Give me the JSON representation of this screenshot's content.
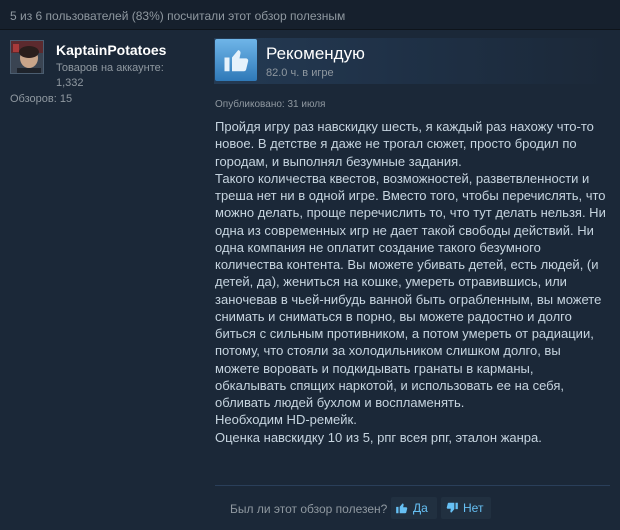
{
  "helpful_summary": "5 из 6 пользователей (83%) посчитали этот обзор полезным",
  "author": {
    "username": "KaptainPotatoes",
    "products_label": "Товаров на аккаунте:",
    "products_count": "1,332",
    "reviews_label": "Обзоров: 15"
  },
  "review": {
    "verdict": "Рекомендую",
    "hours": "82.0 ч. в игре",
    "posted": "Опубликовано: 31 июля",
    "paragraphs": [
      "Пройдя игру раз навскидку шесть, я каждый раз нахожу что-то новое. В детстве я даже не трогал сюжет, просто бродил по городам, и выполнял безумные задания.",
      "Такого количества квестов, возможностей, разветвленности и треша нет ни в одной игре. Вместо того, чтобы перечислять, что можно делать, проще перечислить то, что тут делать нельзя. Ни одна из современных игр не дает такой свободы действий. Ни одна компания не оплатит создание такого безумного количества контента. Вы можете убивать детей, есть людей, (и детей, да), жениться на кошке, умереть отравившись, или заночевав в чьей-нибудь ванной быть ограбленным, вы можете снимать и сниматься в порно, вы можете радостно и долго биться с сильным противником, а потом умереть от радиации, потому, что стояли за холодильником слишком долго, вы можете воровать и подкидывать гранаты в карманы, обкалывать спящих наркотой, и использовать ее на себя, обливать людей бухлом и воспламенять.",
      "Необходим HD-ремейк.",
      "Оценка навскидку 10 из 5, рпг всея рпг, эталон жанра."
    ]
  },
  "footer": {
    "question": "Был ли этот обзор полезен?",
    "yes_label": "Да",
    "no_label": "Нет"
  },
  "icons": {
    "verdict": "thumbs-up-icon",
    "yes": "thumbs-up-icon",
    "no": "thumbs-down-icon"
  },
  "colors": {
    "background": "#1b2838",
    "text": "#c6d4df",
    "accent": "#66c0f4",
    "thumb_blue": "#3d8fd1"
  }
}
